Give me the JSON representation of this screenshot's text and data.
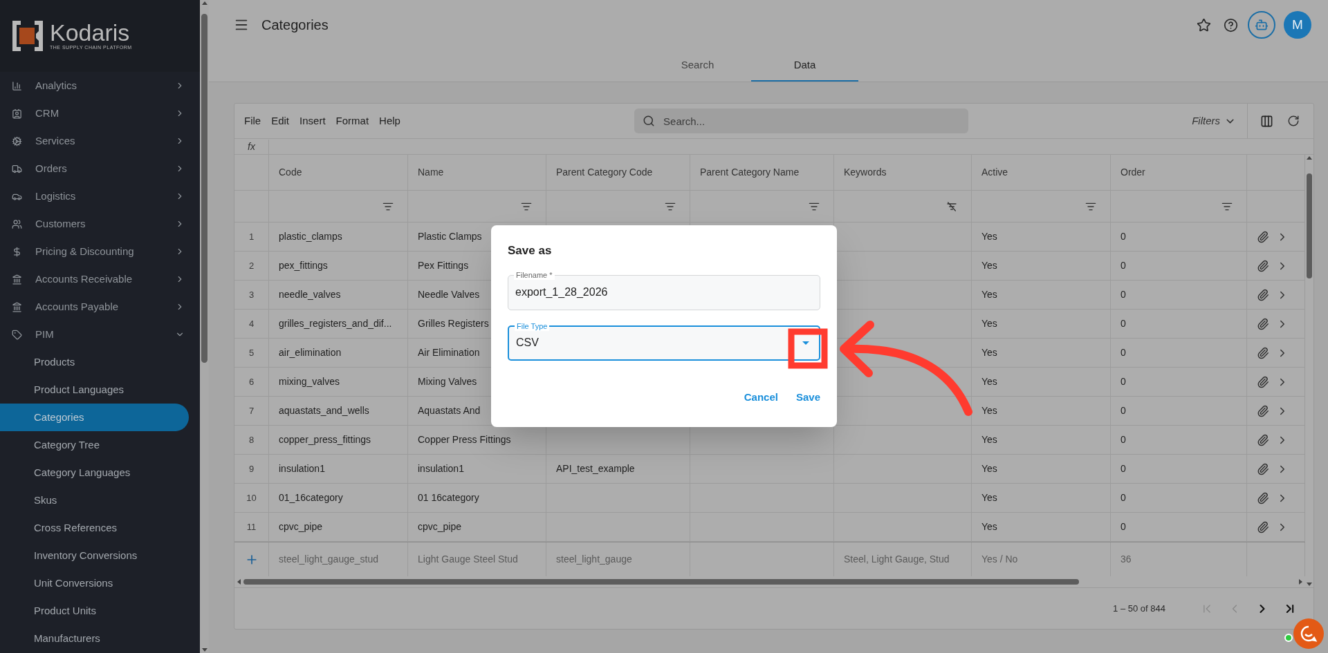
{
  "logo": {
    "name": "Kodaris",
    "tagline": "THE SUPPLY CHAIN PLATFORM"
  },
  "sidebar": {
    "items": [
      {
        "label": "Analytics",
        "expanded": false
      },
      {
        "label": "CRM",
        "expanded": false
      },
      {
        "label": "Services",
        "expanded": false
      },
      {
        "label": "Orders",
        "expanded": false
      },
      {
        "label": "Logistics",
        "expanded": false
      },
      {
        "label": "Customers",
        "expanded": false
      },
      {
        "label": "Pricing & Discounting",
        "expanded": false
      },
      {
        "label": "Accounts Receivable",
        "expanded": false
      },
      {
        "label": "Accounts Payable",
        "expanded": false
      },
      {
        "label": "PIM",
        "expanded": true,
        "children": [
          {
            "label": "Products",
            "selected": false
          },
          {
            "label": "Product Languages",
            "selected": false
          },
          {
            "label": "Categories",
            "selected": true
          },
          {
            "label": "Category Tree",
            "selected": false
          },
          {
            "label": "Category Languages",
            "selected": false
          },
          {
            "label": "Skus",
            "selected": false
          },
          {
            "label": "Cross References",
            "selected": false
          },
          {
            "label": "Inventory Conversions",
            "selected": false
          },
          {
            "label": "Unit Conversions",
            "selected": false
          },
          {
            "label": "Product Units",
            "selected": false
          },
          {
            "label": "Manufacturers",
            "selected": false
          }
        ]
      }
    ]
  },
  "header": {
    "title": "Categories",
    "avatar": "M",
    "tabs": [
      {
        "label": "Search",
        "selected": false
      },
      {
        "label": "Data",
        "selected": true
      }
    ]
  },
  "toolbar": {
    "menu": [
      "File",
      "Edit",
      "Insert",
      "Format",
      "Help"
    ],
    "search": {
      "placeholder": "Search..."
    },
    "filters": "Filters",
    "formula_label": "fx"
  },
  "table": {
    "columns": [
      {
        "label": "Code",
        "filter_off": false
      },
      {
        "label": "Name",
        "filter_off": false
      },
      {
        "label": "Parent Category Code",
        "filter_off": false
      },
      {
        "label": "Parent Category Name",
        "filter_off": false
      },
      {
        "label": "Keywords",
        "filter_off": true
      },
      {
        "label": "Active",
        "filter_off": false
      },
      {
        "label": "Order",
        "filter_off": false
      }
    ],
    "rows": [
      {
        "number": "1",
        "code": "plastic_clamps",
        "name": "Plastic Clamps",
        "active": "Yes",
        "order": "0"
      },
      {
        "number": "2",
        "code": "pex_fittings",
        "name": "Pex Fittings",
        "active": "Yes",
        "order": "0"
      },
      {
        "number": "3",
        "code": "needle_valves",
        "name": "Needle Valves",
        "active": "Yes",
        "order": "0"
      },
      {
        "number": "4",
        "code": "grilles_registers_and_dif...",
        "name": "Grilles Registers",
        "active": "Yes",
        "order": "0"
      },
      {
        "number": "5",
        "code": "air_elimination",
        "name": "Air Elimination",
        "active": "Yes",
        "order": "0"
      },
      {
        "number": "6",
        "code": "mixing_valves",
        "name": "Mixing Valves",
        "active": "Yes",
        "order": "0"
      },
      {
        "number": "7",
        "code": "aquastats_and_wells",
        "name": "Aquastats And",
        "active": "Yes",
        "order": "0"
      },
      {
        "number": "8",
        "code": "copper_press_fittings",
        "name": "Copper Press Fittings",
        "active": "Yes",
        "order": "0"
      },
      {
        "number": "9",
        "code": "insulation1",
        "name": "insulation1",
        "parent_category_code": "API_test_example",
        "active": "Yes",
        "order": "0"
      },
      {
        "number": "10",
        "code": "01_16category",
        "name": "01 16category",
        "active": "Yes",
        "order": "0"
      },
      {
        "number": "11",
        "code": "cpvc_pipe",
        "name": "cpvc_pipe",
        "active": "Yes",
        "order": "0"
      }
    ],
    "new_row": {
      "code": "steel_light_gauge_stud",
      "name": "Light Gauge Steel Stud",
      "parent_category_code": "steel_light_gauge",
      "keywords": "Steel, Light Gauge, Stud",
      "active": "Yes / No",
      "order": "36"
    }
  },
  "pagination": {
    "range": "1 – 50 of 844",
    "buttons": [
      {
        "kind": "first",
        "disabled": true
      },
      {
        "kind": "prev",
        "disabled": true
      },
      {
        "kind": "next",
        "disabled": false
      },
      {
        "kind": "last",
        "disabled": false
      }
    ]
  },
  "dialog": {
    "title": "Save as",
    "fields": [
      {
        "kind": "text",
        "label": "Filename *",
        "value": "export_1_28_2026",
        "focused": false
      },
      {
        "kind": "select",
        "label": "File Type",
        "value": "CSV",
        "focused": true
      }
    ],
    "buttons": [
      "Cancel",
      "Save"
    ]
  }
}
